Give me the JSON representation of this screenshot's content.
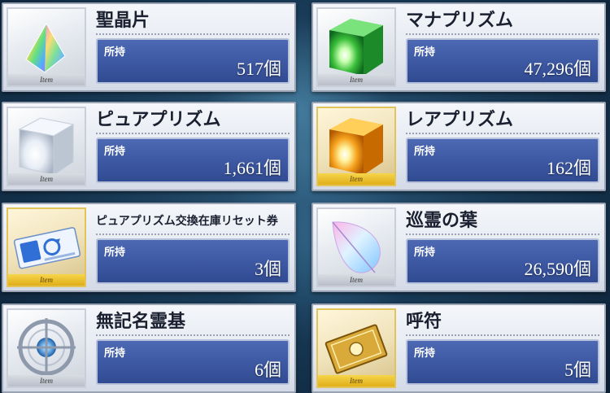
{
  "own_label": "所持",
  "item_tag": "Item",
  "items": [
    {
      "name": "聖晶片",
      "count": "517個",
      "icon": "saint-quartz-fragment-icon"
    },
    {
      "name": "マナプリズム",
      "count": "47,296個",
      "icon": "mana-prism-icon"
    },
    {
      "name": "ピュアプリズム",
      "count": "1,661個",
      "icon": "pure-prism-icon"
    },
    {
      "name": "レアプリズム",
      "count": "162個",
      "icon": "rare-prism-icon"
    },
    {
      "name": "ピュアプリズム交換在庫リセット券",
      "count": "3個",
      "icon": "reset-ticket-icon"
    },
    {
      "name": "巡霊の葉",
      "count": "26,590個",
      "icon": "spirit-leaf-icon"
    },
    {
      "name": "無記名霊基",
      "count": "6個",
      "icon": "unregistered-spirit-origin-icon"
    },
    {
      "name": "呼符",
      "count": "5個",
      "icon": "summon-ticket-icon"
    }
  ],
  "colors": {
    "panel_blue": "#3d58a2",
    "gold_frame": "#e2c45a"
  }
}
